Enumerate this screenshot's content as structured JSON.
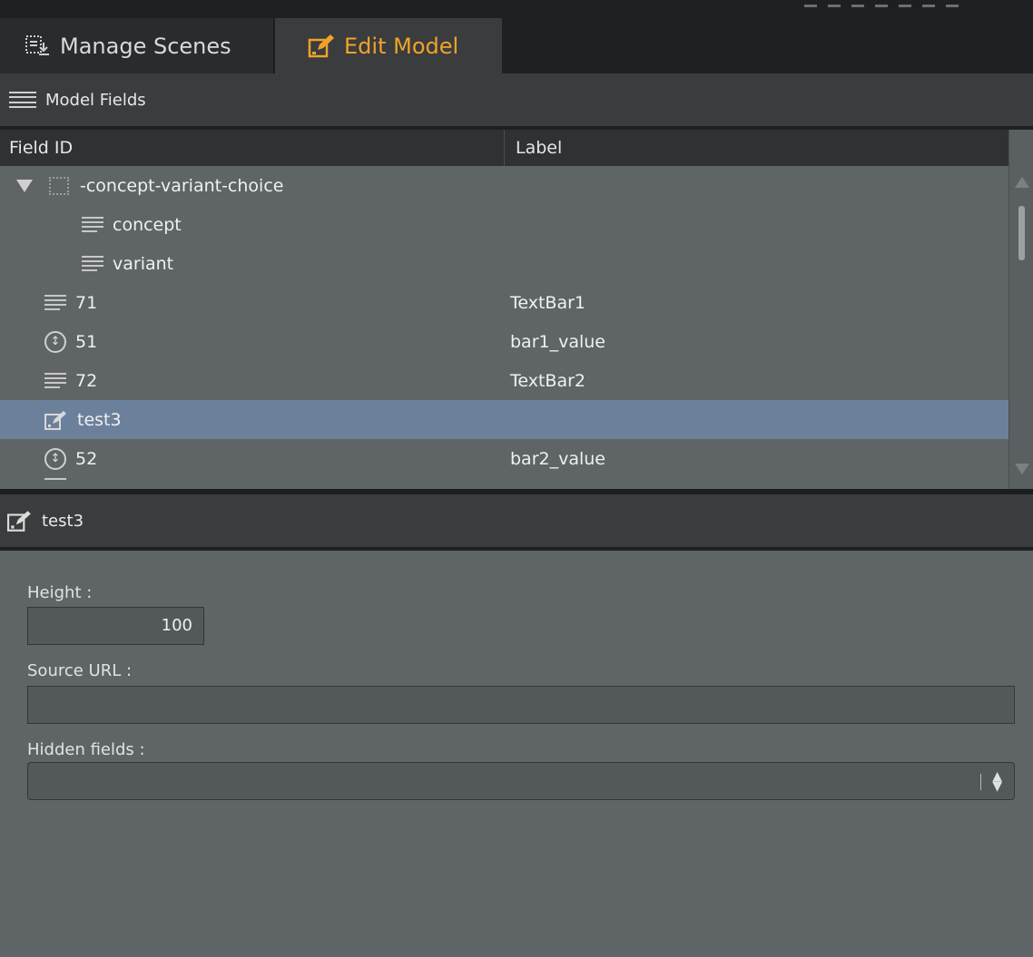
{
  "tabs": {
    "manage_scenes": "Manage Scenes",
    "edit_model": "Edit Model"
  },
  "section": {
    "title": "Model Fields"
  },
  "table": {
    "columns": [
      "Field ID",
      "Label"
    ],
    "rows": [
      {
        "id": "-concept-variant-choice",
        "label": "",
        "icon": "folder-icon",
        "expander": "expand-triangle-icon"
      },
      {
        "id": "concept",
        "label": "",
        "icon": "text-lines-icon"
      },
      {
        "id": "variant",
        "label": "",
        "icon": "text-lines-icon"
      },
      {
        "id": "71",
        "label": "TextBar1",
        "icon": "text-lines-icon"
      },
      {
        "id": "51",
        "label": "bar1_value",
        "icon": "number-stepper-icon"
      },
      {
        "id": "72",
        "label": "TextBar2",
        "icon": "text-lines-icon"
      },
      {
        "id": "test3",
        "label": "",
        "icon": "edit-model-icon",
        "selected": true
      },
      {
        "id": "52",
        "label": "bar2_value",
        "icon": "number-stepper-icon"
      }
    ]
  },
  "detail": {
    "title": "test3",
    "height_label": "Height :",
    "height_value": "100",
    "source_url_label": "Source URL :",
    "source_url_value": "",
    "hidden_fields_label": "Hidden fields :",
    "hidden_fields_value": ""
  },
  "colors": {
    "accent": "#f0a328",
    "selection": "#6b809b",
    "panel": "#5f6466",
    "header": "#3a3c3e"
  }
}
